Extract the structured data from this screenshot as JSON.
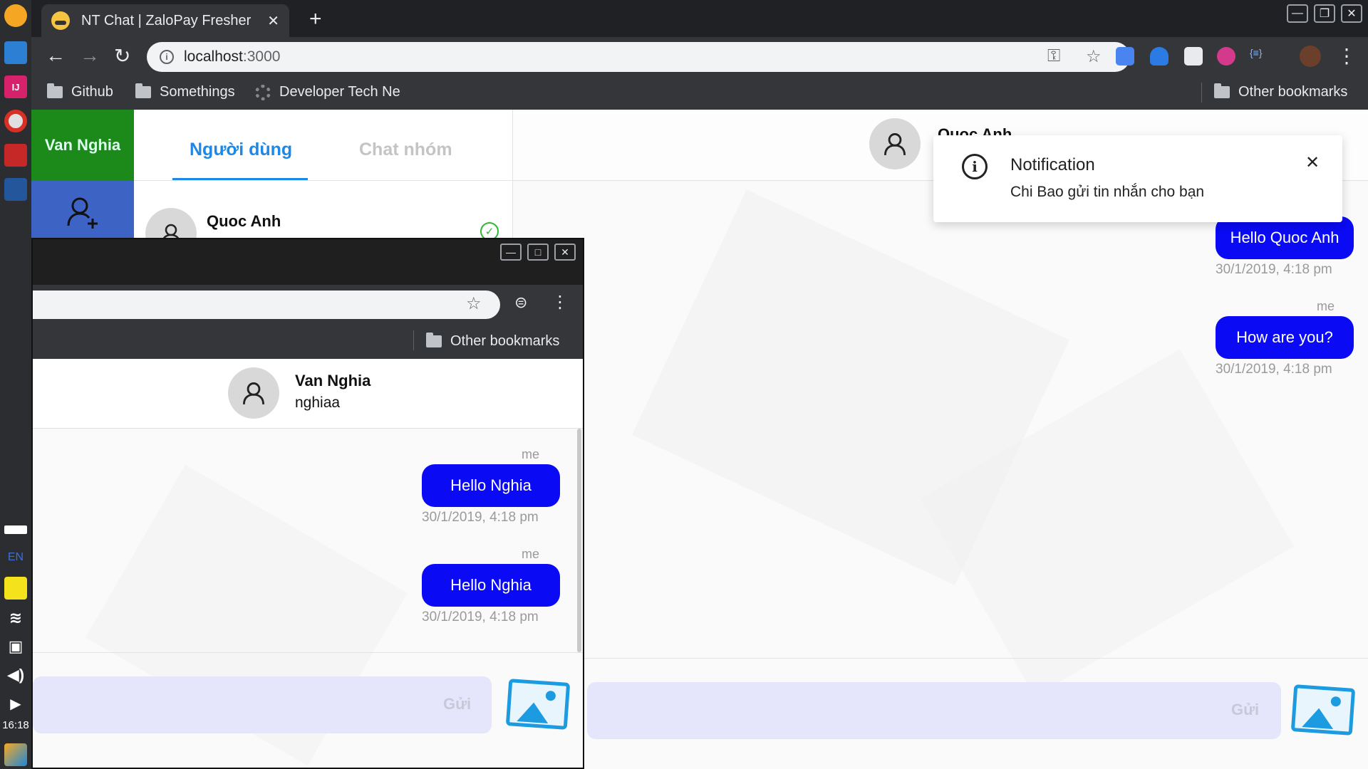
{
  "taskbar": {
    "lang": "EN",
    "clock": "16:18"
  },
  "browser": {
    "tab_title": "NT Chat | ZaloPay Fresher",
    "url_host": "localhost",
    "url_port": ":3000",
    "bookmarks": [
      "Github",
      "Somethings",
      "Developer Tech Ne"
    ],
    "other_bookmarks": "Other bookmarks"
  },
  "app": {
    "current_user": "Van Nghia",
    "tabs": [
      "Người dùng",
      "Chat nhóm"
    ],
    "contacts": [
      {
        "name": "Quoc Anh"
      }
    ],
    "peer": {
      "name": "Quoc Anh"
    },
    "messages": [
      {
        "sender": "me",
        "text": "Hello Quoc Anh",
        "time": "30/1/2019, 4:18 pm"
      },
      {
        "sender": "me",
        "text": "How are you?",
        "time": "30/1/2019, 4:18 pm"
      }
    ],
    "send_label": "Gửi"
  },
  "notification": {
    "title": "Notification",
    "message": "Chi Bao gửi tin nhắn cho bạn"
  },
  "window2": {
    "other_bookmarks": "Other bookmarks",
    "peer": {
      "name": "Van Nghia",
      "username": "nghiaa"
    },
    "messages": [
      {
        "sender": "me",
        "text": "Hello Nghia",
        "time": "30/1/2019, 4:18 pm"
      },
      {
        "sender": "me",
        "text": "Hello Nghia",
        "time": "30/1/2019, 4:18 pm"
      }
    ],
    "send_label": "Gửi"
  },
  "colors": {
    "bubble": "#0a0af5",
    "active_tab": "#1e88e5",
    "user_tile": "#1b8a1b",
    "add_tile": "#3d63c5",
    "composer": "#e5e6fb"
  }
}
